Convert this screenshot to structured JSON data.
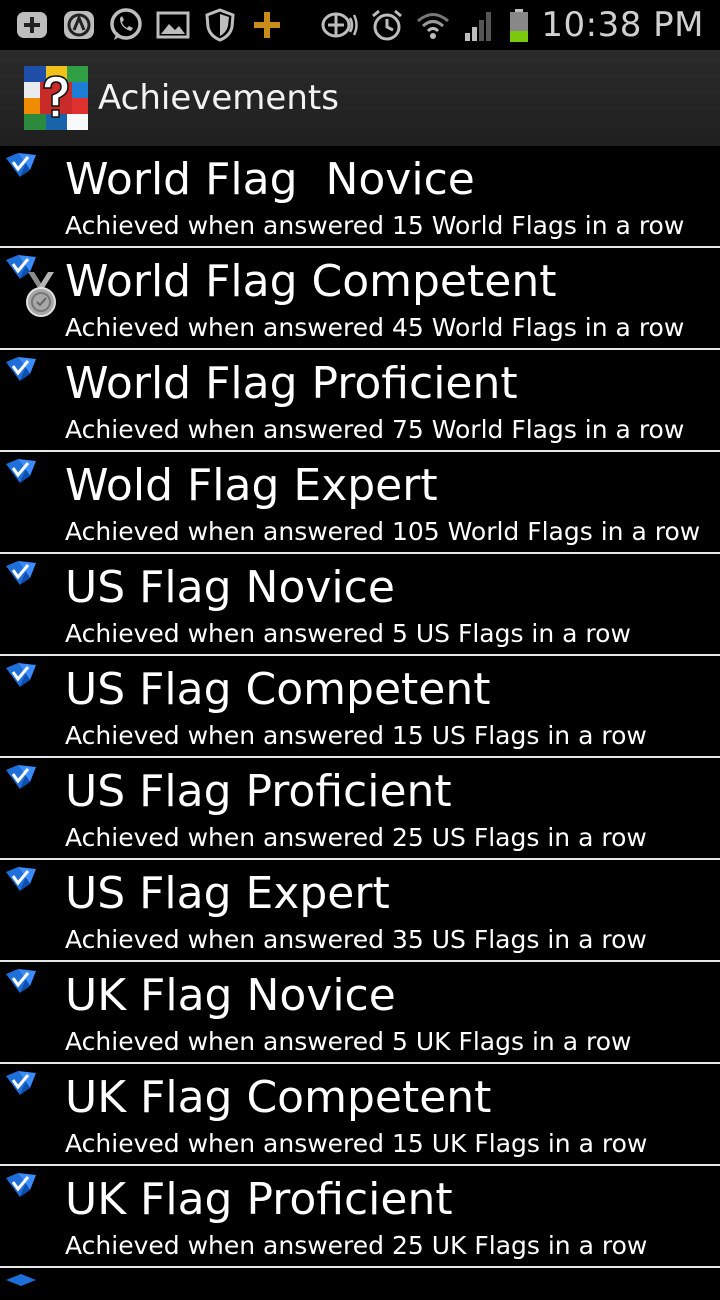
{
  "status_bar": {
    "time": "10:38 PM",
    "left_icons": [
      "add-icon",
      "aviate-icon",
      "whatsapp-icon",
      "gallery-icon",
      "shield-icon",
      "plus-icon"
    ],
    "right_icons": [
      "nfc-icon",
      "alarm-icon",
      "wifi-icon",
      "signal-icon",
      "battery-icon"
    ]
  },
  "action_bar": {
    "title": "Achievements",
    "app_icon": "flags-quiz-icon"
  },
  "achievements": [
    {
      "title": "World Flag  Novice",
      "description": "Achieved when answered 15 World Flags in a row",
      "medal": false
    },
    {
      "title": "World Flag Competent",
      "description": "Achieved when answered 45 World Flags in a row",
      "medal": true
    },
    {
      "title": "World Flag Proficient",
      "description": "Achieved when answered 75 World Flags in a row",
      "medal": false
    },
    {
      "title": "Wold Flag Expert",
      "description": "Achieved when answered 105 World Flags in a row",
      "medal": false
    },
    {
      "title": "US Flag Novice",
      "description": "Achieved when answered 5 US Flags in a row",
      "medal": false
    },
    {
      "title": "US Flag Competent",
      "description": "Achieved when answered 15 US Flags in a row",
      "medal": false
    },
    {
      "title": "US Flag Proficient",
      "description": "Achieved when answered 25 US Flags in a row",
      "medal": false
    },
    {
      "title": "US Flag Expert",
      "description": "Achieved when answered 35 US Flags in a row",
      "medal": false
    },
    {
      "title": "UK Flag Novice",
      "description": "Achieved when answered 5 UK Flags in a row",
      "medal": false
    },
    {
      "title": "UK Flag Competent",
      "description": "Achieved when answered 15 UK Flags in a row",
      "medal": false
    },
    {
      "title": "UK Flag Proficient",
      "description": "Achieved when answered 25 UK Flags in a row",
      "medal": false
    }
  ],
  "colors": {
    "background": "#000000",
    "divider": "#e6e6e6",
    "action_bar": "#262626",
    "badge_blue": "#1e6fd8"
  }
}
